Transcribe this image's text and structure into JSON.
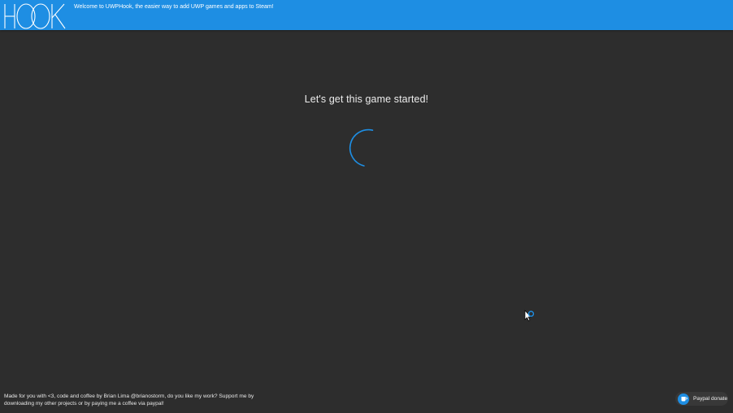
{
  "header": {
    "logo_text": "HOOK",
    "welcome_text": "Welcome to UWPHook, the easier way to add UWP games and apps to Steam!"
  },
  "main": {
    "title": "Let's get this game started!",
    "loading_icon": "spinner-icon"
  },
  "footer": {
    "credits_line1": "Made for you with <3, code and coffee by Brian Lima @brianostorm, do you like my work? Support me by",
    "credits_line2": "downloading my other projects or by paying me a coffee via paypal!",
    "donate_label": "Paypal donate",
    "donate_icon": "coffee-icon"
  },
  "colors": {
    "accent": "#1e8ee3",
    "background": "#2d2d2d",
    "text": "#ffffff"
  }
}
